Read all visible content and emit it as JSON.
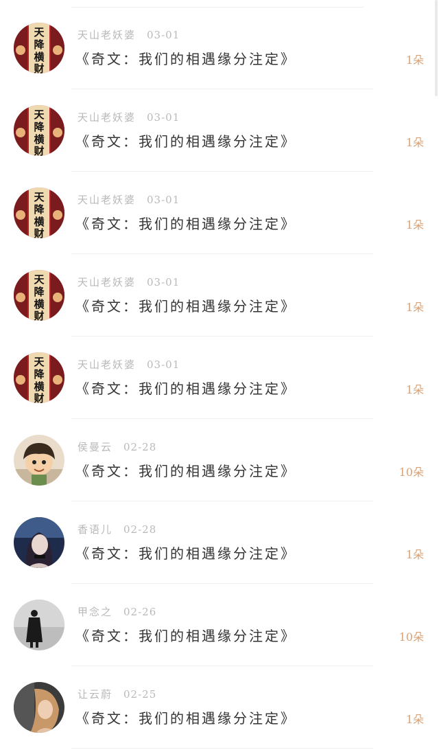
{
  "colors": {
    "count_accent": "#d9a274",
    "meta_text": "#b9b9b9",
    "title_text": "#333333",
    "divider": "#f2f2f2"
  },
  "items": [
    {
      "author": "天山老妖婆",
      "date": "03-01",
      "title": "《奇文：我们的相遇缘分注定》",
      "count": "1朵",
      "avatar": "tianjiang-hengcai-avatar"
    },
    {
      "author": "天山老妖婆",
      "date": "03-01",
      "title": "《奇文：我们的相遇缘分注定》",
      "count": "1朵",
      "avatar": "tianjiang-hengcai-avatar"
    },
    {
      "author": "天山老妖婆",
      "date": "03-01",
      "title": "《奇文：我们的相遇缘分注定》",
      "count": "1朵",
      "avatar": "tianjiang-hengcai-avatar"
    },
    {
      "author": "天山老妖婆",
      "date": "03-01",
      "title": "《奇文：我们的相遇缘分注定》",
      "count": "1朵",
      "avatar": "tianjiang-hengcai-avatar"
    },
    {
      "author": "天山老妖婆",
      "date": "03-01",
      "title": "《奇文：我们的相遇缘分注定》",
      "count": "1朵",
      "avatar": "tianjiang-hengcai-avatar"
    },
    {
      "author": "侯曼云",
      "date": "02-28",
      "title": "《奇文：我们的相遇缘分注定》",
      "count": "10朵",
      "avatar": "cartoon-boy-avatar"
    },
    {
      "author": "香语儿",
      "date": "02-28",
      "title": "《奇文：我们的相遇缘分注定》",
      "count": "1朵",
      "avatar": "girl-portrait-avatar"
    },
    {
      "author": "甲念之",
      "date": "02-26",
      "title": "《奇文：我们的相遇缘分注定》",
      "count": "10朵",
      "avatar": "silhouette-avatar"
    },
    {
      "author": "让云蔚",
      "date": "02-25",
      "title": "《奇文：我们的相遇缘分注定》",
      "count": "1朵",
      "avatar": "woman-portrait-avatar"
    }
  ]
}
